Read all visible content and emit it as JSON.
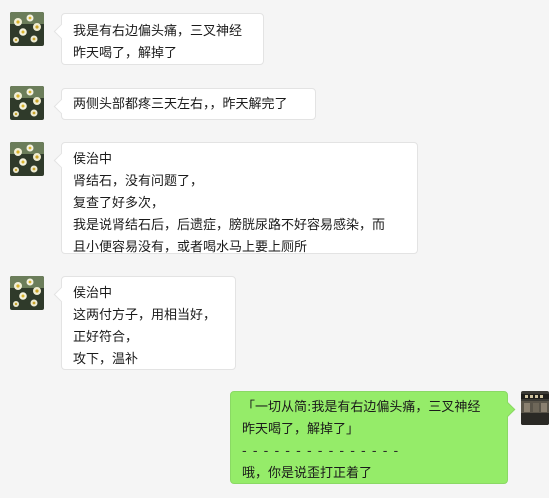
{
  "colors": {
    "background": "#f5f5f5",
    "incoming_bubble": "#ffffff",
    "outgoing_bubble": "#95ec69"
  },
  "messages": [
    {
      "side": "left",
      "lines": [
        "我是有右边偏头痛，三叉神经",
        "昨天喝了，解掉了"
      ]
    },
    {
      "side": "left",
      "lines": [
        "两侧头部都疼三天左右，，昨天解完了"
      ]
    },
    {
      "side": "left",
      "lines": [
        "侯治中",
        "肾结石，没有问题了，",
        "复查了好多次，",
        "我是说肾结石后，后遗症，膀胱尿路不好容易感染，而",
        "且小便容易没有，或者喝水马上要上厕所"
      ]
    },
    {
      "side": "left",
      "lines": [
        "侯治中",
        "这两付方子，用相当好，",
        "正好符合，",
        "攻下，温补"
      ]
    },
    {
      "side": "right",
      "lines": [
        "「一切从简:我是有右边偏头痛，三叉神经",
        "昨天喝了，解掉了」",
        "- - - - - - - - - - - - - - -",
        "哦，你是说歪打正着了"
      ]
    }
  ]
}
